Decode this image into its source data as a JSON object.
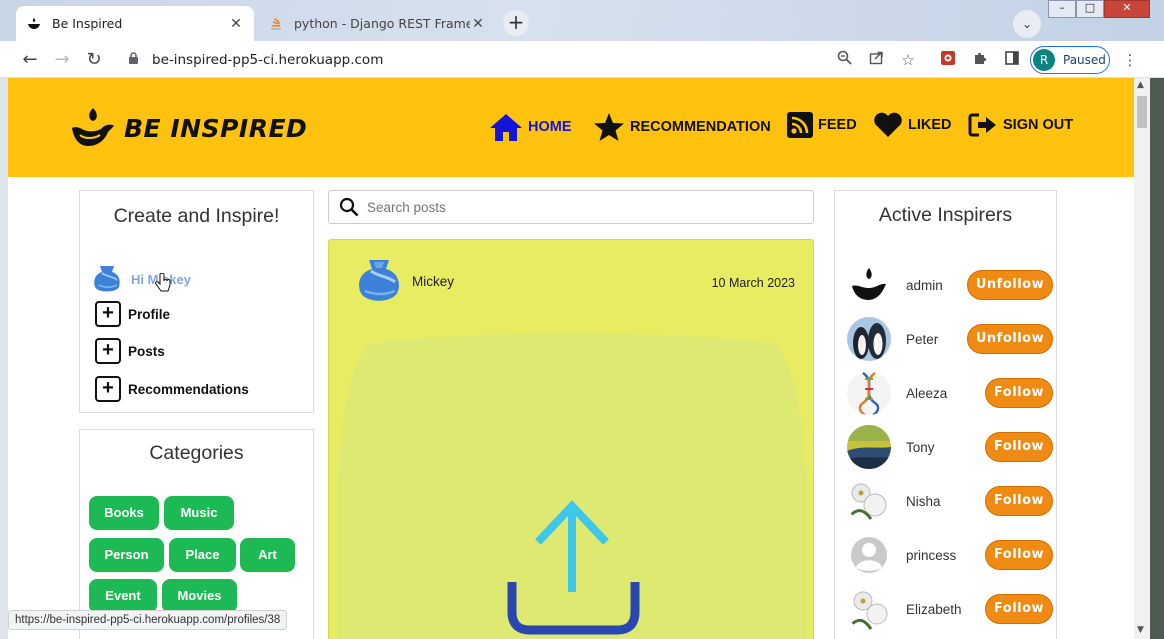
{
  "browser": {
    "tabs": [
      {
        "title": "Be Inspired"
      },
      {
        "title": "python - Django REST Framework"
      }
    ],
    "url": "be-inspired-pp5-ci.herokuapp.com",
    "profile_initial": "R",
    "profile_status": "Paused",
    "status_url": "https://be-inspired-pp5-ci.herokuapp.com/profiles/38"
  },
  "site": {
    "brand": "BE INSPIRED",
    "nav": {
      "home": "HOME",
      "recommendation": "RECOMMENDATION",
      "feed": "FEED",
      "liked": "LIKED",
      "sign_out": "SIGN OUT"
    },
    "colors": {
      "header": "#ffc20e",
      "category": "#1db954",
      "follow": "#ef8a12",
      "post": "#e7ec63"
    }
  },
  "left": {
    "create_title": "Create and Inspire!",
    "greeting": "Hi Mickey",
    "links": {
      "profile": "Profile",
      "posts": "Posts",
      "recommendations": "Recommendations"
    },
    "categories_title": "Categories",
    "categories": [
      "Books",
      "Music",
      "Person",
      "Place",
      "Art",
      "Event",
      "Movies"
    ]
  },
  "center": {
    "search_placeholder": "Search posts",
    "post": {
      "author": "Mickey",
      "date": "10 March 2023"
    }
  },
  "right": {
    "title": "Active Inspirers",
    "inspirers": [
      {
        "name": "admin",
        "action": "Unfollow"
      },
      {
        "name": "Peter",
        "action": "Unfollow"
      },
      {
        "name": "Aleeza",
        "action": "Follow"
      },
      {
        "name": "Tony",
        "action": "Follow"
      },
      {
        "name": "Nisha",
        "action": "Follow"
      },
      {
        "name": "princess",
        "action": "Follow"
      },
      {
        "name": "Elizabeth",
        "action": "Follow"
      }
    ]
  }
}
